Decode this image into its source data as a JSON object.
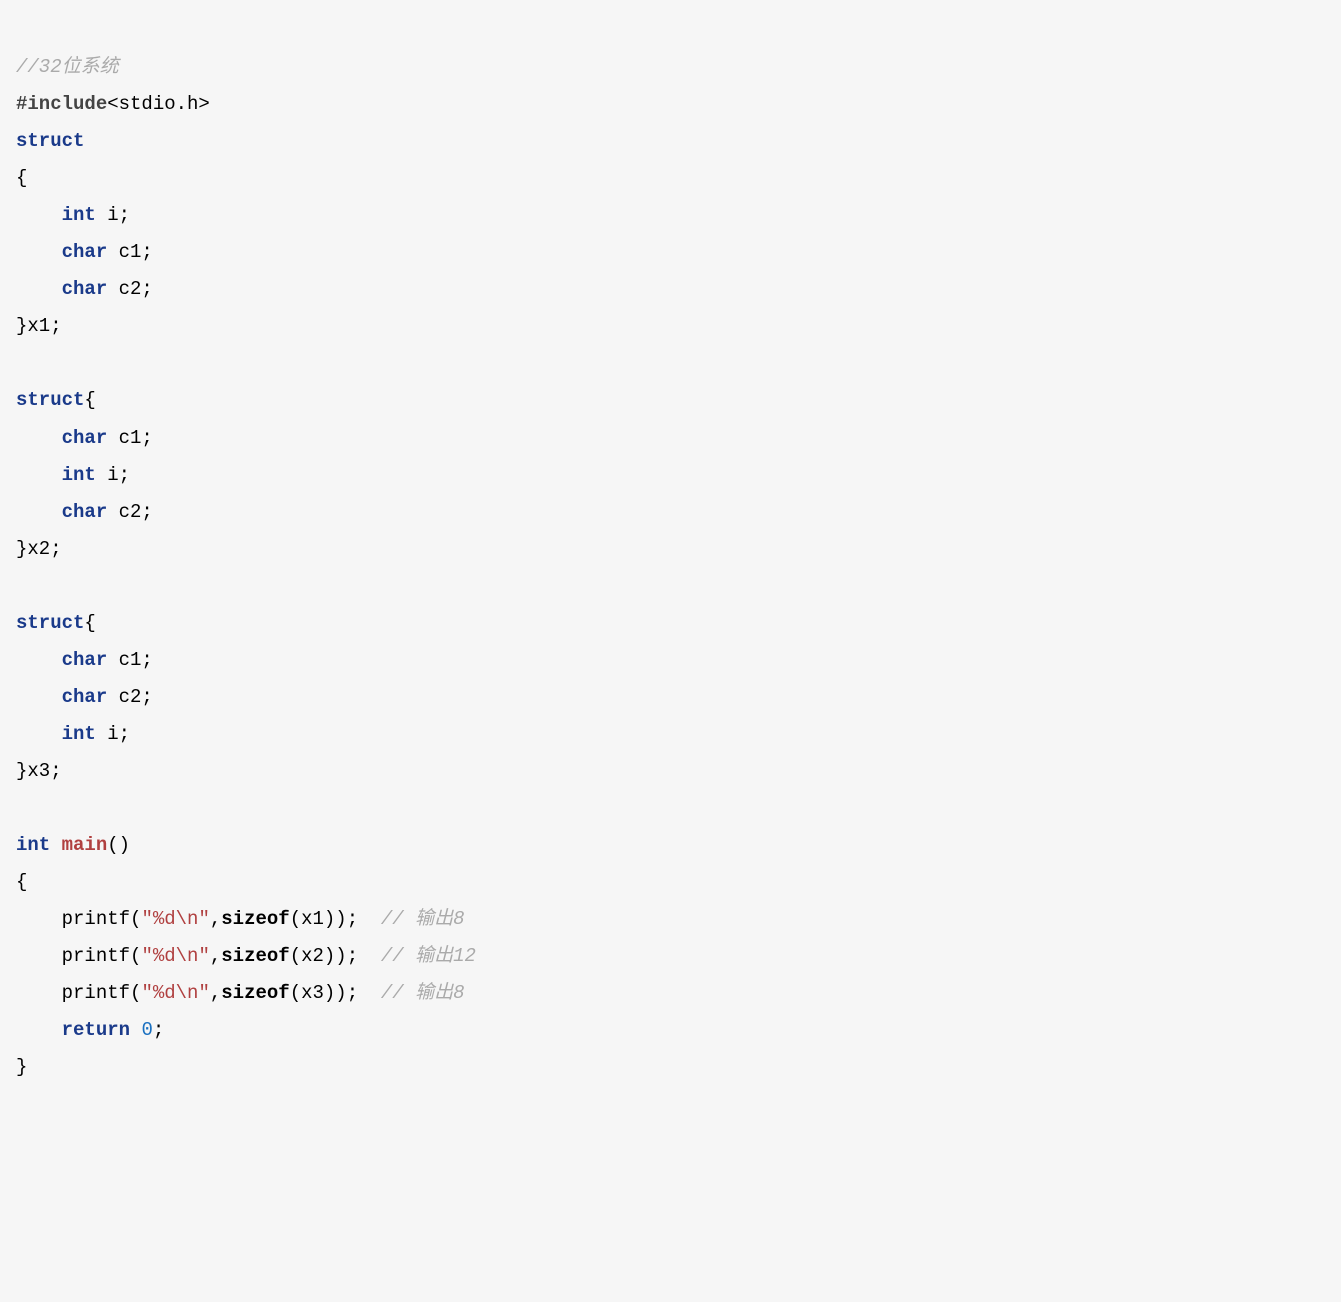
{
  "code": {
    "l1_comment": "//32位系统",
    "l2_directive": "#include",
    "l2_header": "<stdio.h>",
    "l3_struct": "struct",
    "l4_brace": "{",
    "l5_int": "int",
    "l5_var": " i;",
    "l6_char": "char",
    "l6_var": " c1;",
    "l7_char": "char",
    "l7_var": " c2;",
    "l8_close": "}x1;",
    "l10_struct": "struct",
    "l10_brace": "{",
    "l11_char": "char",
    "l11_var": " c1;",
    "l12_int": "int",
    "l12_var": " i;",
    "l13_char": "char",
    "l13_var": " c2;",
    "l14_close": "}x2;",
    "l16_struct": "struct",
    "l16_brace": "{",
    "l17_char": "char",
    "l17_var": " c1;",
    "l18_char": "char",
    "l18_var": " c2;",
    "l19_int": "int",
    "l19_var": " i;",
    "l20_close": "}x3;",
    "l22_int": "int",
    "l22_main": "main",
    "l22_paren": "()",
    "l23_brace": "{",
    "l24_printf": "printf(",
    "l24_str": "\"%d\\n\"",
    "l24_comma": ",",
    "l24_sizeof": "sizeof",
    "l24_arg": "(x1));  ",
    "l24_comment": "// 输出8",
    "l25_printf": "printf(",
    "l25_str": "\"%d\\n\"",
    "l25_comma": ",",
    "l25_sizeof": "sizeof",
    "l25_arg": "(x2));  ",
    "l25_comment": "// 输出12",
    "l26_printf": "printf(",
    "l26_str": "\"%d\\n\"",
    "l26_comma": ",",
    "l26_sizeof": "sizeof",
    "l26_arg": "(x3));  ",
    "l26_comment": "// 输出8",
    "l27_return": "return",
    "l27_zero": "0",
    "l27_semi": ";",
    "l28_brace": "}",
    "indent": "    "
  }
}
